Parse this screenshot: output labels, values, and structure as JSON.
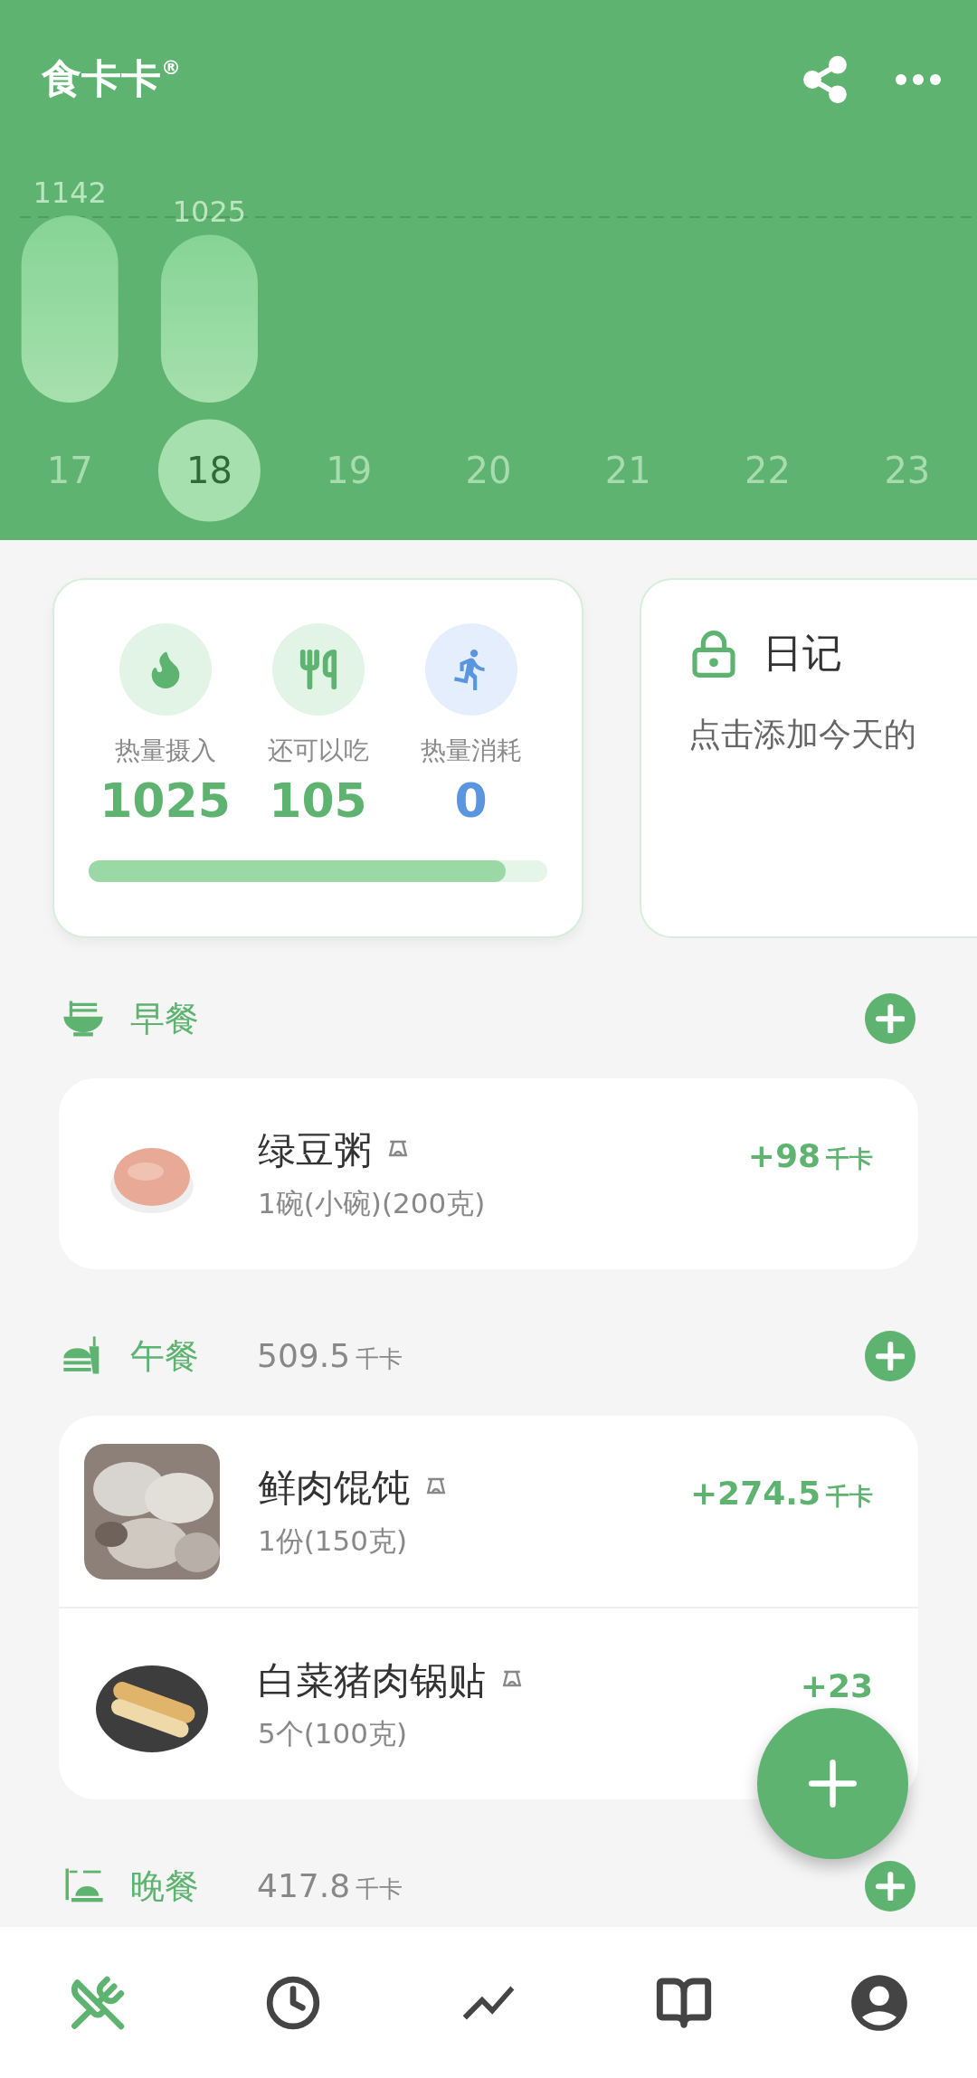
{
  "app_bar": {
    "title": "食卡卡",
    "mark": "®"
  },
  "calorie_chart": {
    "chart_data": {
      "type": "bar",
      "categories": [
        "17",
        "18",
        "19",
        "20",
        "21",
        "22",
        "23"
      ],
      "values": [
        1142,
        1025,
        null,
        null,
        null,
        null,
        null
      ],
      "data_labels": true
    }
  },
  "days": [
    {
      "selected": false
    },
    {
      "selected": true
    },
    {
      "selected": false
    },
    {
      "selected": false
    },
    {
      "selected": false
    },
    {
      "selected": false
    },
    {
      "selected": false
    }
  ],
  "summary": {
    "stats": [
      {
        "kind": "intake",
        "label": "热量摄入",
        "value": "1025"
      },
      {
        "kind": "remaining",
        "label": "还可以吃",
        "value": "105"
      },
      {
        "kind": "burned",
        "label": "热量消耗",
        "value": "0"
      }
    ],
    "level": 0.91
  },
  "diary": {
    "title": "日记",
    "hint": "点击添加今天的"
  },
  "meals": [
    {
      "kind": "breakfast",
      "title": "早餐",
      "items": [
        {
          "name": "绿豆粥",
          "portion": "1碗(小碗)(200克)",
          "kcal": "+98",
          "unit": "千卡"
        }
      ]
    },
    {
      "kind": "lunch",
      "title": "午餐",
      "total": "509.5",
      "unit": "千卡",
      "items": [
        {
          "name": "鲜肉馄饨",
          "portion": "1份(150克)",
          "kcal": "+274.5",
          "unit": "千卡"
        },
        {
          "name": "白菜猪肉锅贴",
          "portion": "5个(100克)",
          "kcal": "+23"
        }
      ]
    },
    {
      "kind": "dinner",
      "title": "晚餐",
      "total": "417.8",
      "unit": "千卡"
    }
  ],
  "bottom_nav": [
    {
      "selected": true
    },
    {
      "selected": false
    },
    {
      "selected": false
    },
    {
      "selected": false
    },
    {
      "selected": false
    }
  ]
}
